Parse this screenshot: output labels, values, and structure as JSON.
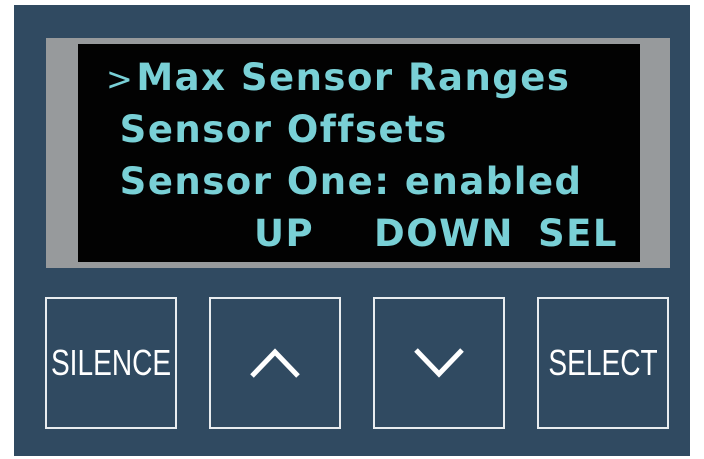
{
  "display": {
    "cursor": ">",
    "lines": [
      "Max Sensor Ranges",
      "Sensor Offsets",
      "Sensor One: enabled"
    ],
    "softkeys": {
      "up": "UP",
      "down": "DOWN",
      "select": "SEL"
    }
  },
  "buttons": {
    "silence_label": "SILENCE",
    "up_icon": "chevron-up-icon",
    "down_icon": "chevron-down-icon",
    "select_label": "SELECT"
  },
  "colors": {
    "panel": "#304a61",
    "bezel": "#979a9c",
    "lcd_background": "#020202",
    "lcd_text": "#79d0d6",
    "button_border": "#e8ecef",
    "button_text": "#ffffff"
  }
}
